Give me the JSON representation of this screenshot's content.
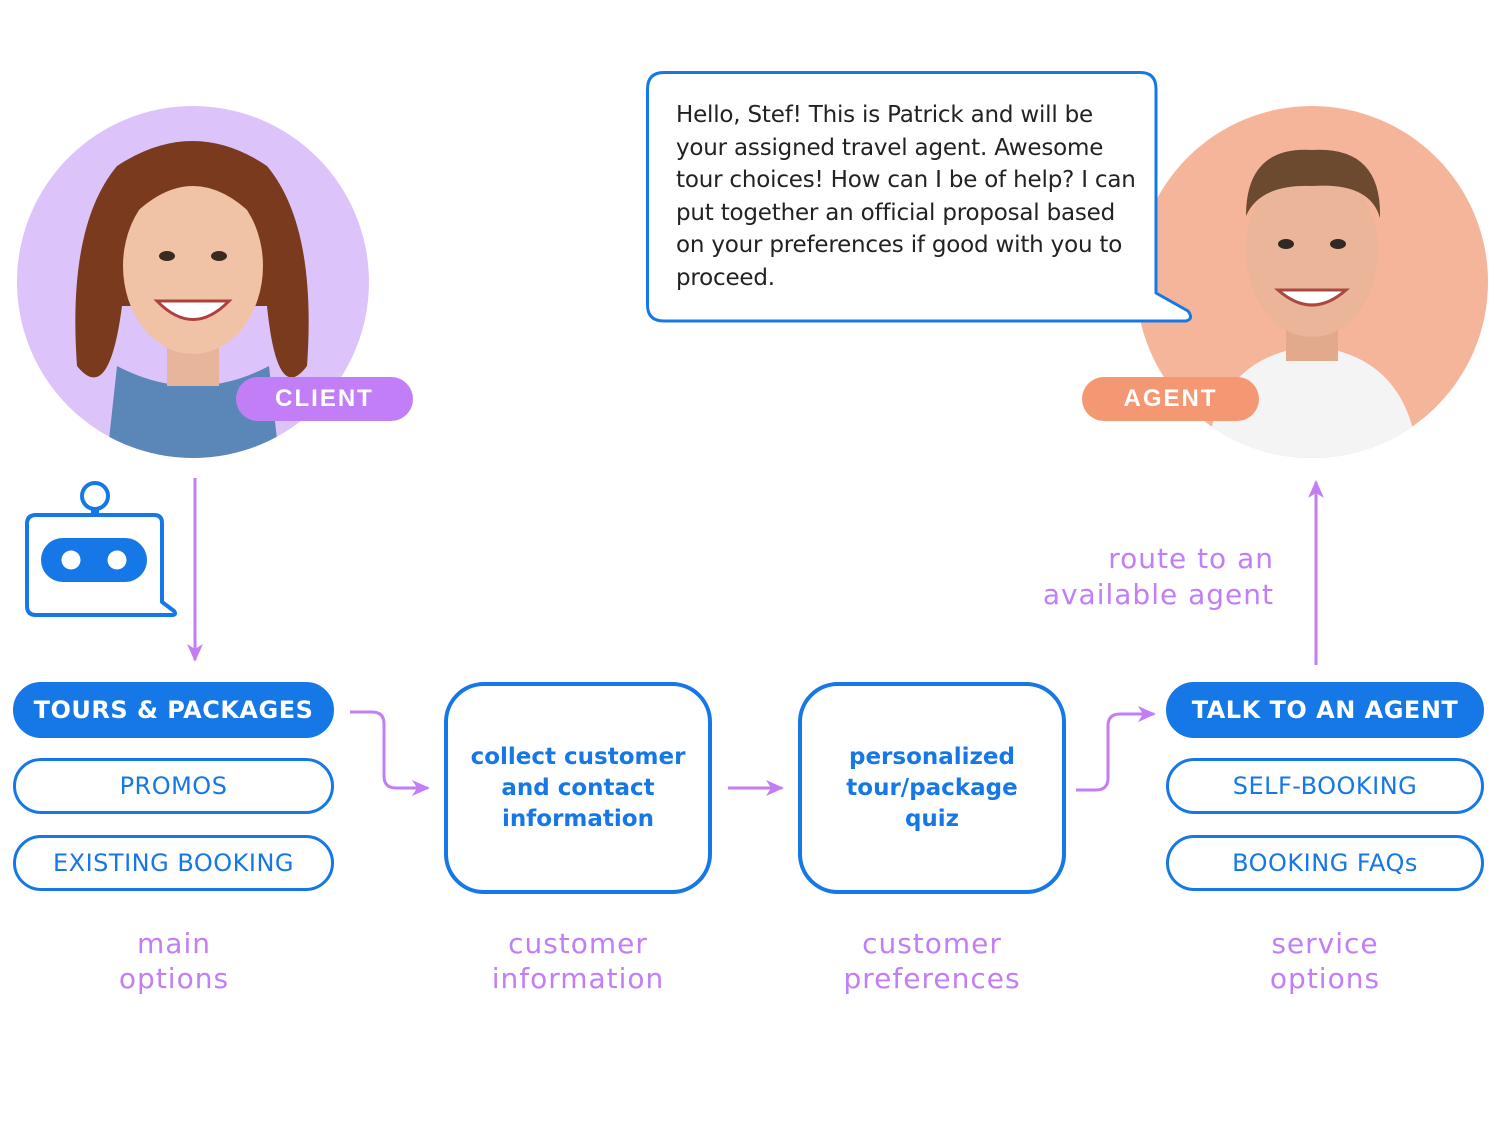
{
  "client": {
    "role_label": "CLIENT",
    "circle_color": "#dcc4fb",
    "badge_color": "#c27ef7"
  },
  "agent": {
    "role_label": "AGENT",
    "circle_color": "#f5b59a",
    "badge_color": "#f49874",
    "message": "Hello, Stef! This is Patrick and will be your assigned travel agent. Awesome tour choices! How can I be of help? I can put together an official proposal based on your preferences if good with you to proceed."
  },
  "chatbot": {
    "icon": "robot-chat-icon"
  },
  "main_options": {
    "items": [
      {
        "label": "TOURS & PACKAGES",
        "selected": true
      },
      {
        "label": "PROMOS",
        "selected": false
      },
      {
        "label": "EXISTING BOOKING",
        "selected": false
      }
    ],
    "caption": [
      "main",
      "options"
    ]
  },
  "steps": [
    {
      "text": [
        "collect customer",
        "and contact",
        "information"
      ],
      "caption": [
        "customer",
        "information"
      ]
    },
    {
      "text": [
        "personalized",
        "tour/package",
        "quiz"
      ],
      "caption": [
        "customer",
        "preferences"
      ]
    }
  ],
  "service_options": {
    "items": [
      {
        "label": "TALK TO AN AGENT",
        "selected": true
      },
      {
        "label": "SELF-BOOKING",
        "selected": false
      },
      {
        "label": "BOOKING FAQs",
        "selected": false
      }
    ],
    "caption": [
      "service",
      "options"
    ]
  },
  "route_label": [
    "route to an",
    "available agent"
  ],
  "colors": {
    "primary_blue": "#1677e6",
    "accent_purple": "#c27ef7",
    "text_dark": "#222222"
  }
}
